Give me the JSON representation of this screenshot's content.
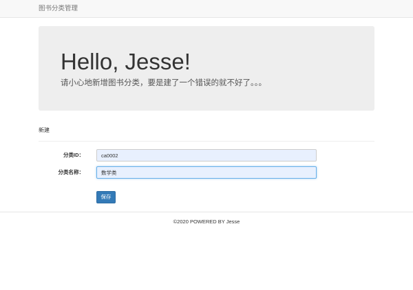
{
  "navbar": {
    "brand": "图书分类管理"
  },
  "jumbotron": {
    "heading": "Hello, Jesse!",
    "lead": "请小心地新增图书分类，要是建了一个错误的就不好了。。。"
  },
  "form": {
    "title": "新建",
    "fields": [
      {
        "label": "分类ID：",
        "value": "ca0002"
      },
      {
        "label": "分类名称：",
        "value": "数学类"
      }
    ],
    "save_label": "保存"
  },
  "footer": {
    "text": "©2020 POWERED BY Jesse"
  }
}
